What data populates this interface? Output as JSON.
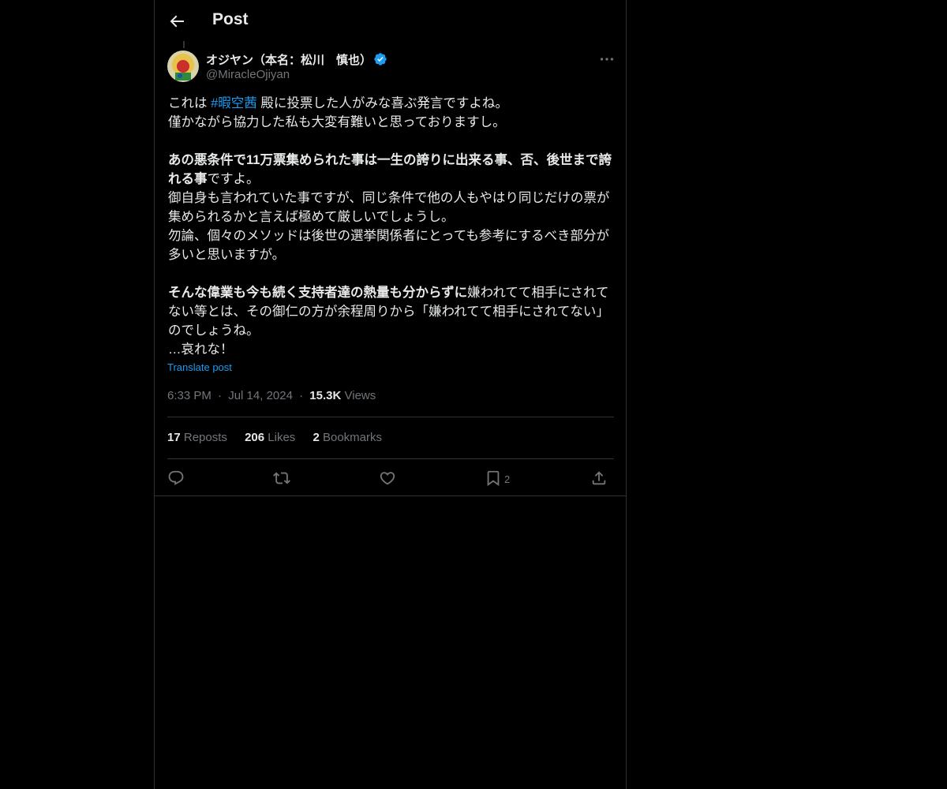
{
  "header": {
    "title": "Post"
  },
  "author": {
    "display_name": "オジヤン（本名：松川　慎也）",
    "handle": "@MiracleOjiyan",
    "verified": true
  },
  "post": {
    "p1_before": "これは ",
    "p1_hashtag": "#暇空茜",
    "p1_after": " 殿に投票した人がみな喜ぶ発言ですよね。",
    "p2": "僅かながら協力した私も大変有難いと思っておりますし。",
    "p3_bold": "あの悪条件で11万票集められた事は一生の誇りに出来る事、否、後世まで誇れる事",
    "p3_rest": "ですよ。",
    "p4": "御自身も言われていた事ですが、同じ条件で他の人もやはり同じだけの票が集められるかと言えば極めて厳しいでしょうし。",
    "p5": "勿論、個々のメソッドは後世の選挙関係者にとっても参考にするべき部分が多いと思いますが。",
    "p6_bold": "そんな偉業も今も続く支持者達の熱量も分からずに",
    "p6_rest": "嫌われてて相手にされてない等とは、その御仁の方が余程周りから「嫌われてて相手にされてない」のでしょうね。",
    "p7": "…哀れな！",
    "translate_label": "Translate post"
  },
  "meta": {
    "time": "6:33 PM",
    "sep": "·",
    "date": "Jul 14, 2024",
    "views_count": "15.3K",
    "views_label": "Views"
  },
  "stats": {
    "reposts_count": "17",
    "reposts_label": "Reposts",
    "likes_count": "206",
    "likes_label": "Likes",
    "bookmarks_count": "2",
    "bookmarks_label": "Bookmarks"
  },
  "actions": {
    "bookmark_count": "2"
  },
  "colors": {
    "background": "#000000",
    "text": "#e7e9ea",
    "secondary": "#71767b",
    "accent": "#1d9bf0",
    "border": "#2f3336"
  },
  "icons": [
    "back-arrow-icon",
    "verified-badge-icon",
    "more-icon",
    "reply-icon",
    "repost-icon",
    "like-icon",
    "bookmark-icon",
    "share-icon"
  ]
}
